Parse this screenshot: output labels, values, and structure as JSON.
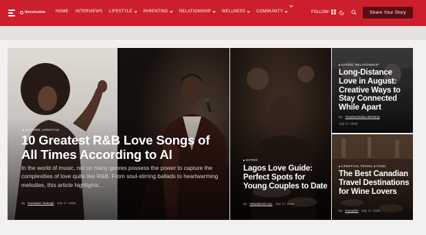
{
  "header": {
    "logo_text": "thevoiceline",
    "nav": [
      {
        "label": "HOME",
        "has_dropdown": false
      },
      {
        "label": "INTERVIEWS",
        "has_dropdown": false
      },
      {
        "label": "LIFESTYLE",
        "has_dropdown": true
      },
      {
        "label": "PARENTING",
        "has_dropdown": true
      },
      {
        "label": "RELATIONSHIP",
        "has_dropdown": true
      },
      {
        "label": "WELLNESS",
        "has_dropdown": true
      },
      {
        "label": "COMMUNITY",
        "has_dropdown": true
      }
    ],
    "follow_label": "FOLLOW",
    "share_button": "Share Your Story",
    "colors": {
      "bar": "#cc1f2b",
      "button": "#5a0e14"
    }
  },
  "articles": {
    "lead": {
      "categories": "CULTURE, LIFESTYLE",
      "title": "10 Greatest R&B Love Songs of All Times According to AI",
      "excerpt": "In the world of music, not so many genres possess the power to capture the complexities of love quite like R&B. From soul-stirring ballads to heartwarming melodies, this article highlights...",
      "by": "By",
      "author": "Kumashe Yaakugh",
      "date": "July 17, 2025"
    },
    "middle": {
      "categories": "DATING",
      "title": "Lagos Love Guide: Perfect Spots for Young Couples to Date",
      "by": "By",
      "author": "Oluwafunmi Ayo",
      "date": "July 17, 2025"
    },
    "top_right": {
      "categories": "DATING, RELATIONSHIP",
      "title": "Long-Distance Love in August: Creative Ways to Stay Connected While Apart",
      "by": "By",
      "author": "Onyekachukwu Blessing",
      "date": "July 17, 2025"
    },
    "bottom_right": {
      "categories": "LIFESTYLE, TRAVEL & FOOD",
      "title": "The Best Canadian Travel Destinations for Wine Lovers",
      "by": "By",
      "author": "Kumashe",
      "date": "July 17, 2025"
    }
  }
}
